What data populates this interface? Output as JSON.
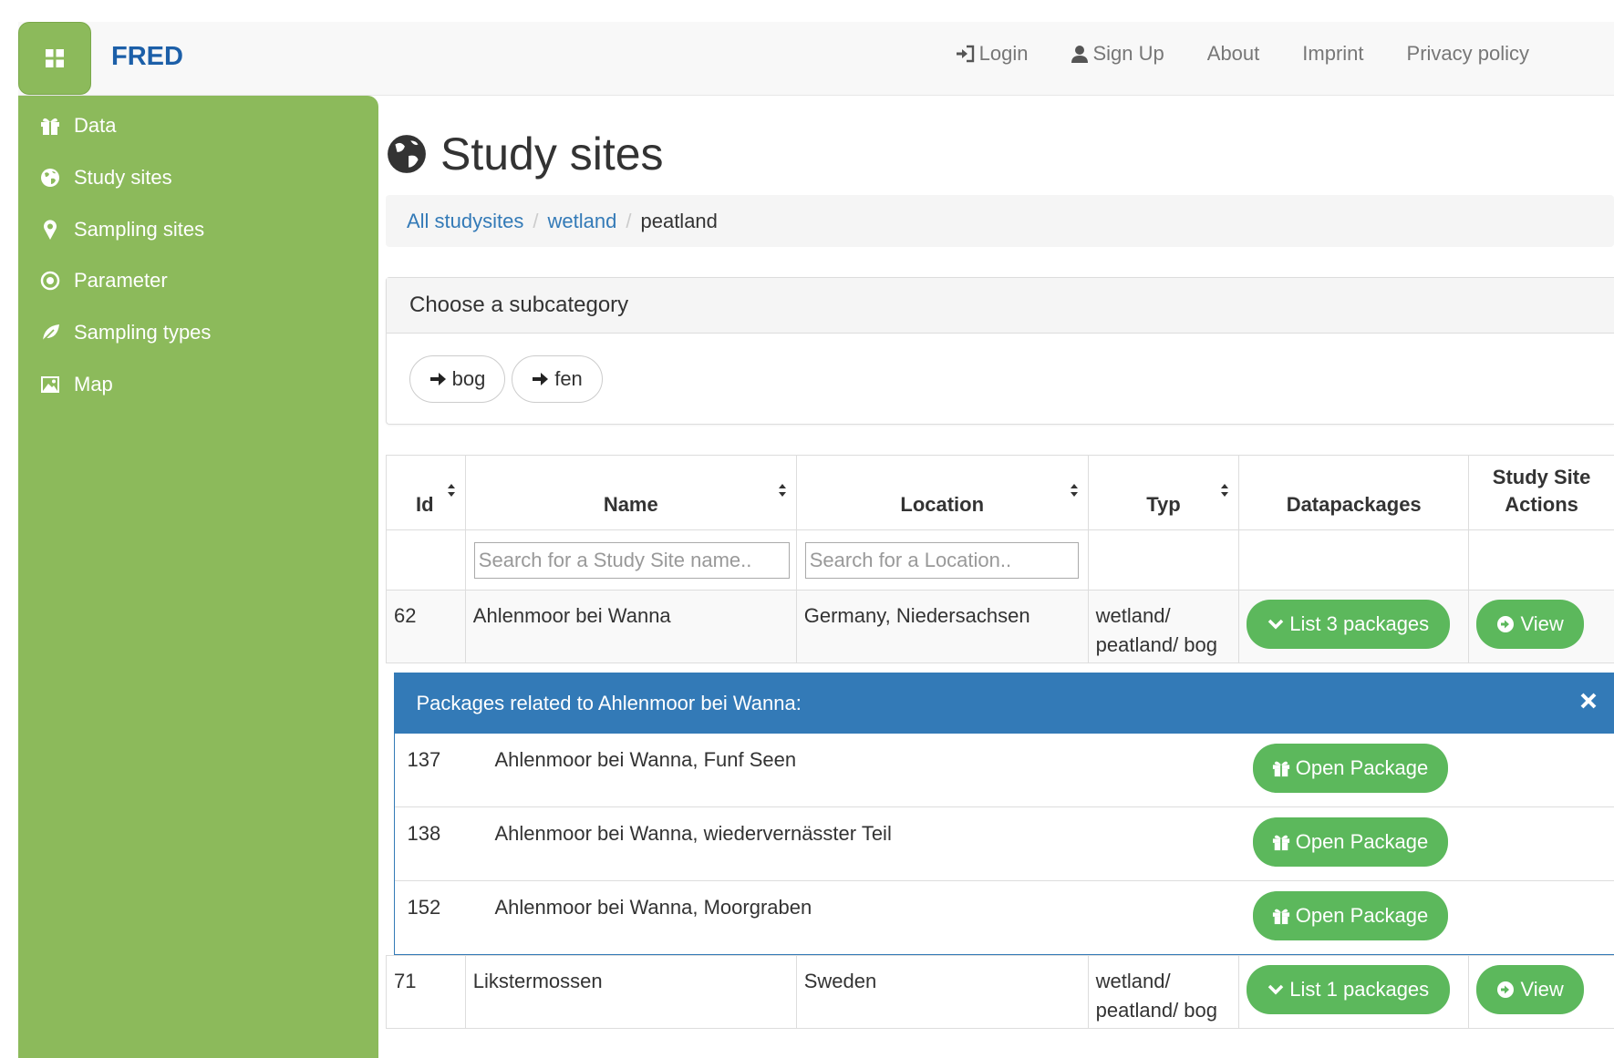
{
  "app": {
    "brand": "FRED"
  },
  "nav": {
    "login": "Login",
    "signup": "Sign Up",
    "about": "About",
    "imprint": "Imprint",
    "privacy": "Privacy policy"
  },
  "sidebar": {
    "items": [
      {
        "label": "Data",
        "icon": "gift-icon"
      },
      {
        "label": "Study sites",
        "icon": "globe-icon"
      },
      {
        "label": "Sampling sites",
        "icon": "map-marker-icon"
      },
      {
        "label": "Parameter",
        "icon": "record-icon"
      },
      {
        "label": "Sampling types",
        "icon": "leaf-icon"
      },
      {
        "label": "Map",
        "icon": "picture-icon"
      }
    ]
  },
  "page": {
    "title": "Study sites"
  },
  "breadcrumb": {
    "items": [
      "All studysites",
      "wetland",
      "peatland"
    ]
  },
  "subcategory": {
    "heading": "Choose a subcategory",
    "buttons": [
      "bog",
      "fen"
    ]
  },
  "table": {
    "headers": [
      "Id",
      "Name",
      "Location",
      "Typ",
      "Datapackages",
      "Study Site Actions"
    ],
    "search_name_placeholder": "Search for a Study Site name..",
    "search_location_placeholder": "Search for a Location..",
    "view_label": "View",
    "rows": [
      {
        "id": "62",
        "name": "Ahlenmoor bei Wanna",
        "location": "Germany, Niedersachsen",
        "typ_line1": "wetland/",
        "typ_line2": "peatland/ bog",
        "packages_label": "List 3 packages"
      },
      {
        "id": "71",
        "name": "Likstermossen",
        "location": "Sweden",
        "typ_line1": "wetland/",
        "typ_line2": "peatland/ bog",
        "packages_label": "List 1 packages"
      }
    ]
  },
  "packages": {
    "heading": "Packages related to Ahlenmoor bei Wanna:",
    "open_label": "Open Package",
    "items": [
      {
        "id": "137",
        "name": "Ahlenmoor bei Wanna, Funf Seen"
      },
      {
        "id": "138",
        "name": "Ahlenmoor bei Wanna, wiedervernässter Teil"
      },
      {
        "id": "152",
        "name": "Ahlenmoor bei Wanna, Moorgraben"
      }
    ]
  },
  "colors": {
    "sidebar_green": "#8cba5b",
    "button_green": "#5cb85c",
    "panel_blue": "#337ab7",
    "brand_blue": "#1c5fa8"
  }
}
